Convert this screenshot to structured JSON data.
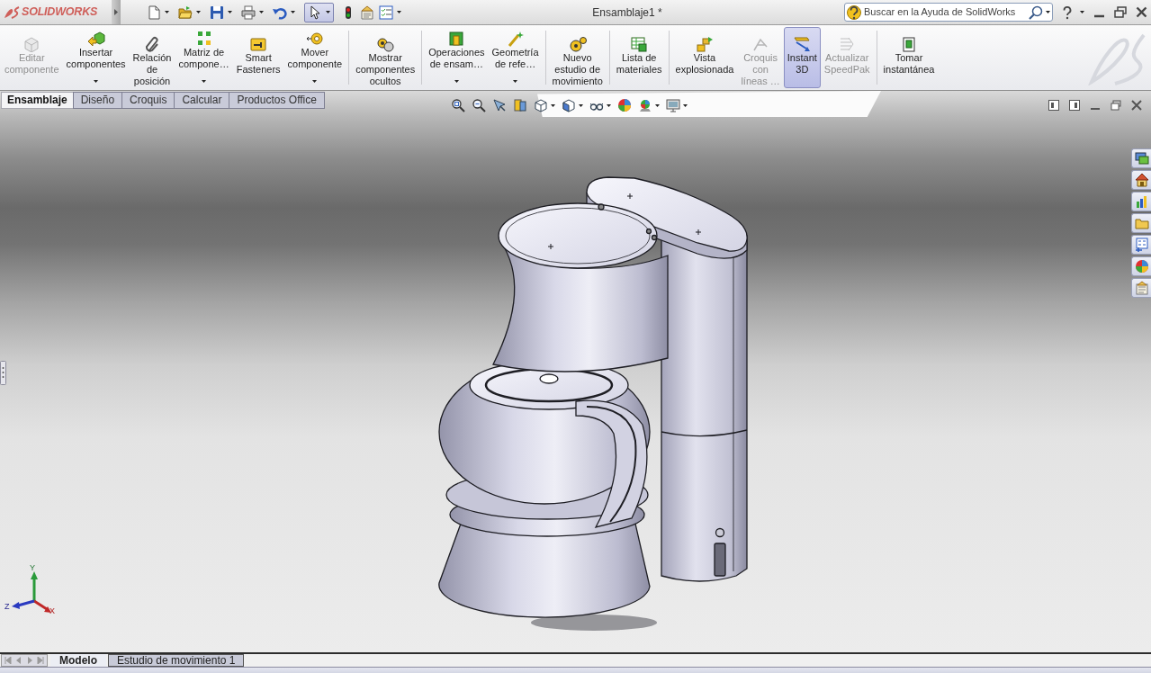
{
  "window": {
    "title": "Ensamblaje1 *",
    "logo_text": "SOLIDWORKS"
  },
  "quick_access": {
    "select_tool": {
      "selected": true
    }
  },
  "search": {
    "placeholder": "Buscar en la Ayuda de SolidWorks"
  },
  "ribbon": {
    "groups": [
      [
        {
          "label": "Editar\ncomponente",
          "disabled": true,
          "has_menu": false,
          "pressed": false
        },
        {
          "label": "Insertar\ncomponentes",
          "disabled": false,
          "has_menu": true,
          "pressed": false
        },
        {
          "label": "Relación\nde\nposición",
          "disabled": false,
          "has_menu": false,
          "pressed": false
        },
        {
          "label": "Matriz de\ncompone…",
          "disabled": false,
          "has_menu": true,
          "pressed": false
        },
        {
          "label": "Smart\nFasteners",
          "disabled": false,
          "has_menu": false,
          "pressed": false
        },
        {
          "label": "Mover\ncomponente",
          "disabled": false,
          "has_menu": true,
          "pressed": false
        }
      ],
      [
        {
          "label": "Mostrar\ncomponentes\nocultos",
          "disabled": false,
          "has_menu": false,
          "pressed": false
        }
      ],
      [
        {
          "label": "Operaciones\nde ensam…",
          "disabled": false,
          "has_menu": true,
          "pressed": false
        },
        {
          "label": "Geometría\nde refe…",
          "disabled": false,
          "has_menu": true,
          "pressed": false
        }
      ],
      [
        {
          "label": "Nuevo\nestudio de\nmovimiento",
          "disabled": false,
          "has_menu": false,
          "pressed": false
        }
      ],
      [
        {
          "label": "Lista de\nmateriales",
          "disabled": false,
          "has_menu": false,
          "pressed": false
        }
      ],
      [
        {
          "label": "Vista\nexplosionada",
          "disabled": false,
          "has_menu": false,
          "pressed": false
        },
        {
          "label": "Croquis\ncon\nlíneas …",
          "disabled": true,
          "has_menu": false,
          "pressed": false
        },
        {
          "label": "Instant\n3D",
          "disabled": false,
          "has_menu": false,
          "pressed": true
        },
        {
          "label": "Actualizar\nSpeedPak",
          "disabled": true,
          "has_menu": false,
          "pressed": false
        }
      ],
      [
        {
          "label": "Tomar\ninstantánea",
          "disabled": false,
          "has_menu": false,
          "pressed": false
        }
      ]
    ]
  },
  "command_tabs": [
    {
      "label": "Ensamblaje",
      "selected": true
    },
    {
      "label": "Diseño",
      "selected": false
    },
    {
      "label": "Croquis",
      "selected": false
    },
    {
      "label": "Calcular",
      "selected": false
    },
    {
      "label": "Productos Office",
      "selected": false
    }
  ],
  "triad": {
    "x": "X",
    "y": "Y",
    "z": "Z"
  },
  "bottom_tabs": [
    {
      "label": "Modelo",
      "selected": true
    },
    {
      "label": "Estudio de movimiento 1",
      "selected": false
    }
  ]
}
